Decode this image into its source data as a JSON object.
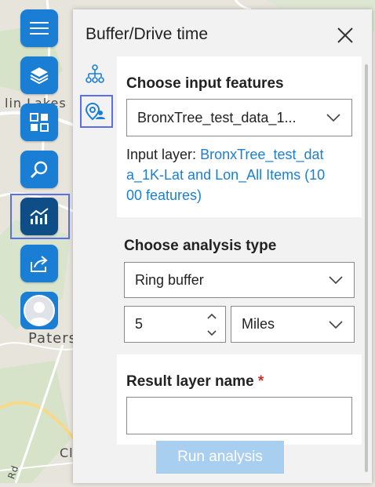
{
  "map": {
    "labels": [
      "lin Lakes",
      "Paters",
      "Cl",
      "Rd"
    ]
  },
  "toolbar": {
    "buttons": [
      {
        "name": "menu",
        "icon": "hamburger-icon"
      },
      {
        "name": "layers",
        "icon": "layers-icon"
      },
      {
        "name": "basemap",
        "icon": "grid-icon"
      },
      {
        "name": "search",
        "icon": "search-icon"
      },
      {
        "name": "analysis",
        "icon": "chart-icon",
        "active": true
      },
      {
        "name": "share",
        "icon": "share-icon"
      },
      {
        "name": "account",
        "icon": "avatar-icon"
      }
    ]
  },
  "panel": {
    "title": "Buffer/Drive time",
    "side_tabs": [
      {
        "icon": "org-chart-icon"
      },
      {
        "icon": "location-user-icon",
        "active": true
      }
    ],
    "input_section": {
      "title": "Choose input features",
      "selected_value": "BronxTree_test_data_1...",
      "input_layer_label": "Input layer: ",
      "input_layer_link_line1": "BronxTree_test_dat",
      "input_layer_link_line2": "a_1K-Lat and Lon_All Items (10",
      "input_layer_link_line3": "00 features)"
    },
    "analysis_section": {
      "title": "Choose analysis type",
      "type_value": "Ring buffer",
      "distance_value": "5",
      "unit_value": "Miles"
    },
    "result_section": {
      "title": "Result layer name",
      "required_mark": "*",
      "value": ""
    },
    "run_button_label": "Run analysis"
  },
  "colors": {
    "accent": "#1a7fd4",
    "accent_dark": "#0e4d86",
    "focus": "#5b6fe8",
    "run_disabled": "#a8cff0",
    "required": "#c8302a"
  }
}
